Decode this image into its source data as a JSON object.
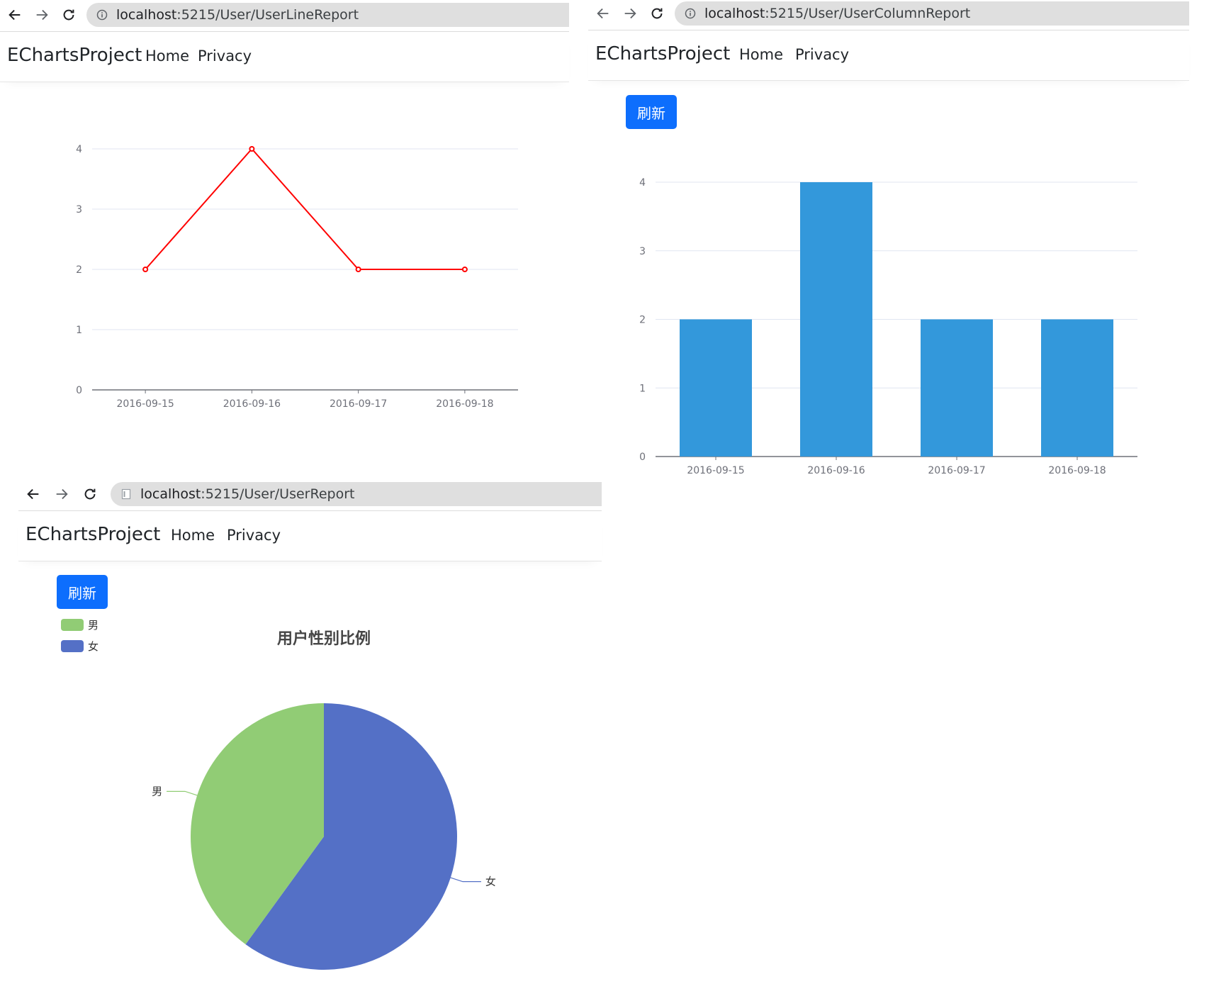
{
  "windows": {
    "line": {
      "url_host": "localhost",
      "url_rest": ":5215/User/UserLineReport",
      "brand": "EChartsProject",
      "nav": [
        "Home",
        "Privacy"
      ]
    },
    "column": {
      "url_host": "localhost",
      "url_rest": ":5215/User/UserColumnReport",
      "brand": "EChartsProject",
      "nav": [
        "Home",
        "Privacy"
      ],
      "refresh_label": "刷新"
    },
    "pie": {
      "url_host": "localhost",
      "url_rest": ":5215/User/UserReport",
      "brand": "EChartsProject",
      "nav": [
        "Home",
        "Privacy"
      ],
      "refresh_label": "刷新"
    }
  },
  "chart_data": [
    {
      "type": "line",
      "categories": [
        "2016-09-15",
        "2016-09-16",
        "2016-09-17",
        "2016-09-18"
      ],
      "values": [
        2,
        4,
        2,
        2
      ],
      "ylim": [
        0,
        4
      ],
      "yticks": [
        0,
        1,
        2,
        3,
        4
      ],
      "color": "#ff0000",
      "grid": true
    },
    {
      "type": "bar",
      "categories": [
        "2016-09-15",
        "2016-09-16",
        "2016-09-17",
        "2016-09-18"
      ],
      "values": [
        2,
        4,
        2,
        2
      ],
      "ylim": [
        0,
        4
      ],
      "yticks": [
        0,
        1,
        2,
        3,
        4
      ],
      "color": "#3398db",
      "grid": true
    },
    {
      "type": "pie",
      "title": "用户性别比例",
      "legend_position": "top-left",
      "slices": [
        {
          "name": "男",
          "value": 40,
          "color": "#91cc75"
        },
        {
          "name": "女",
          "value": 60,
          "color": "#5470c6"
        }
      ]
    }
  ]
}
